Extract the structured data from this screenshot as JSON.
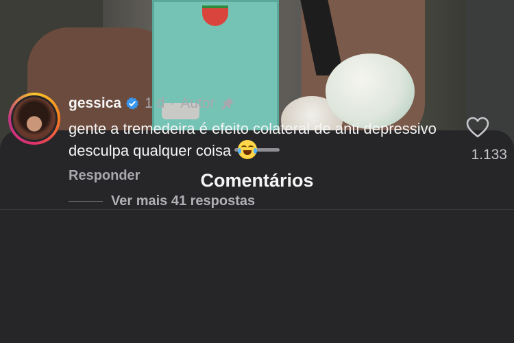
{
  "sheet": {
    "title": "Comentários"
  },
  "comment": {
    "username": "gessica",
    "verified": true,
    "time": "1 d",
    "separator": "·",
    "role": "Autor",
    "text": "gente a tremedeira é efeito colateral de anti depressivo desculpa qualquer coisa",
    "emoji": "face-with-tears-of-joy",
    "reply_label": "Responder",
    "likes": "1.133",
    "more_replies_label": "Ver mais 41 respostas"
  },
  "icons": {
    "verified": "verified-badge-icon",
    "pin": "pin-icon",
    "like": "heart-icon"
  },
  "colors": {
    "sheet_bg": "#262629",
    "verified": "#3897f0",
    "secondary_text": "#a8a8ad"
  }
}
